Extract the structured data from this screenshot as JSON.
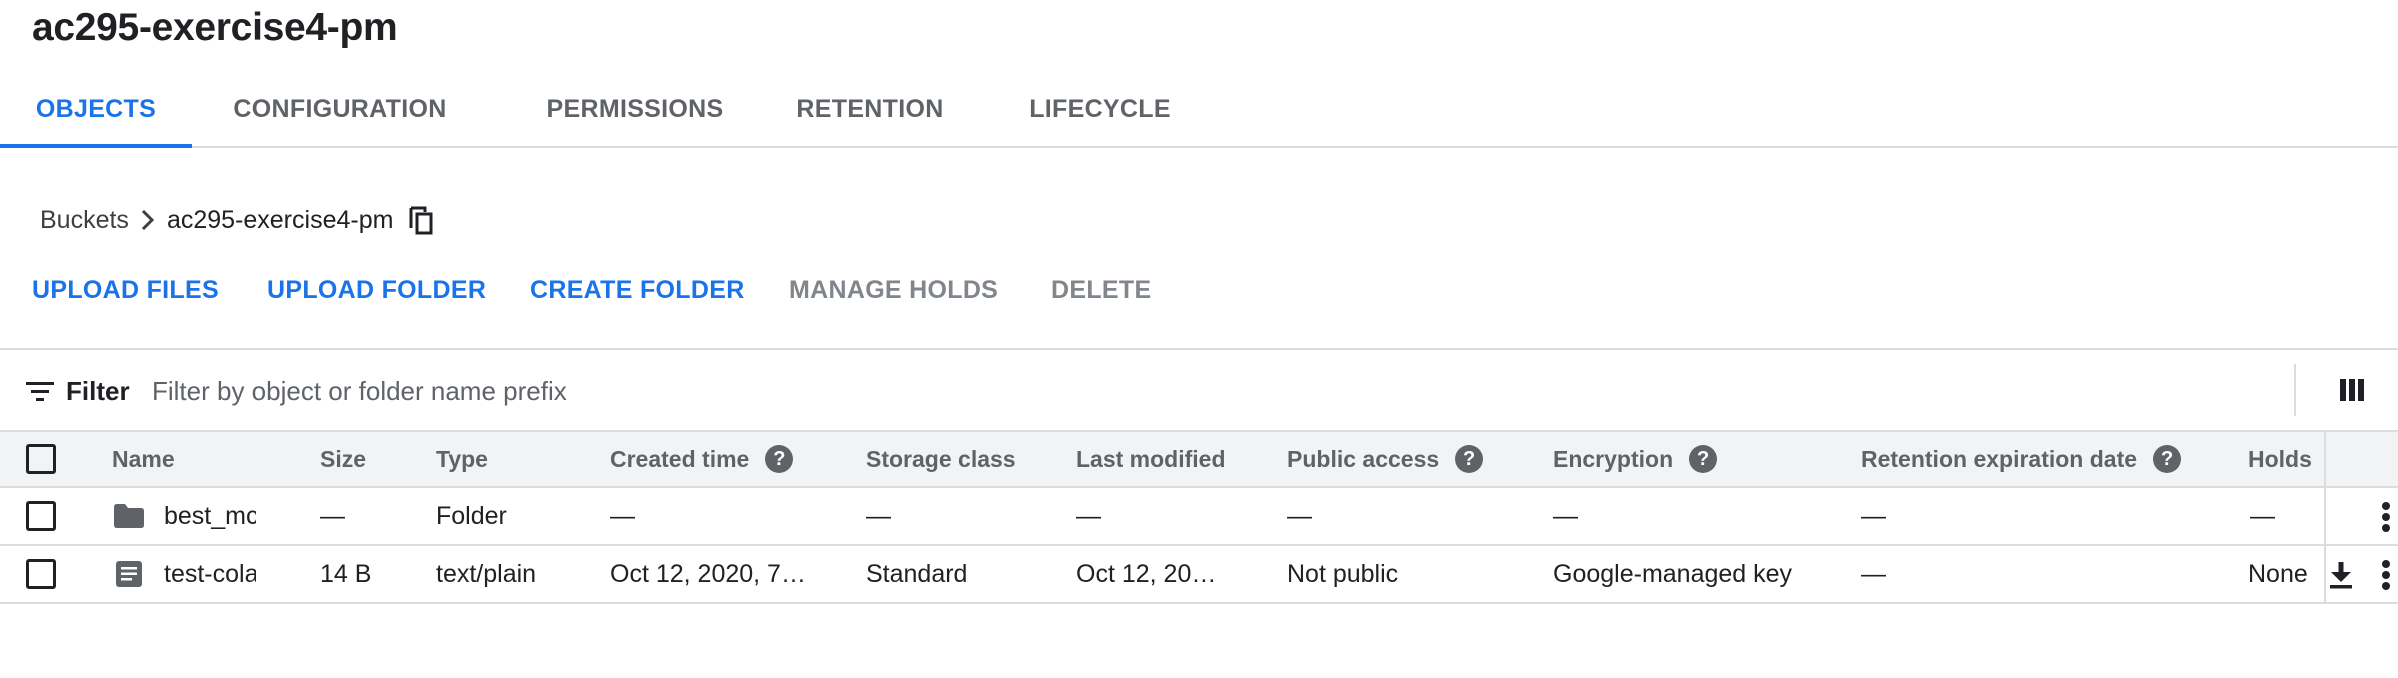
{
  "bucket_title": "ac295-exercise4-pm",
  "tabs": [
    {
      "label": "OBJECTS",
      "active": true
    },
    {
      "label": "CONFIGURATION",
      "active": false
    },
    {
      "label": "PERMISSIONS",
      "active": false
    },
    {
      "label": "RETENTION",
      "active": false
    },
    {
      "label": "LIFECYCLE",
      "active": false
    }
  ],
  "breadcrumb": {
    "root": "Buckets",
    "current": "ac295-exercise4-pm"
  },
  "actions": {
    "upload_files": "UPLOAD FILES",
    "upload_folder": "UPLOAD FOLDER",
    "create_folder": "CREATE FOLDER",
    "manage_holds": "MANAGE HOLDS",
    "delete": "DELETE"
  },
  "filter": {
    "label": "Filter",
    "placeholder": "Filter by object or folder name prefix"
  },
  "columns": {
    "name": "Name",
    "size": "Size",
    "type": "Type",
    "created": "Created time",
    "storage_class": "Storage class",
    "last_modified": "Last modified",
    "public_access": "Public access",
    "encryption": "Encryption",
    "retention": "Retention expiration date",
    "holds": "Holds"
  },
  "help_glyph": "?",
  "rows": [
    {
      "icon": "folder-icon",
      "name": "best_mc",
      "size": "—",
      "type": "Folder",
      "created": "—",
      "storage_class": "—",
      "last_modified": "—",
      "public_access": "—",
      "encryption": "—",
      "retention": "—",
      "holds": "—"
    },
    {
      "icon": "file-icon",
      "name": "test-cola",
      "size": "14 B",
      "type": "text/plain",
      "created": "Oct 12, 2020, 7…",
      "storage_class": "Standard",
      "last_modified": "Oct 12, 20…",
      "public_access": "Not public",
      "encryption": "Google-managed key",
      "retention": "—",
      "holds": "None"
    }
  ],
  "colors": {
    "accent": "#1a73e8",
    "text": "#202124",
    "muted": "#5f6368",
    "divider": "#dadce0",
    "header_bg": "#f1f3f4"
  }
}
